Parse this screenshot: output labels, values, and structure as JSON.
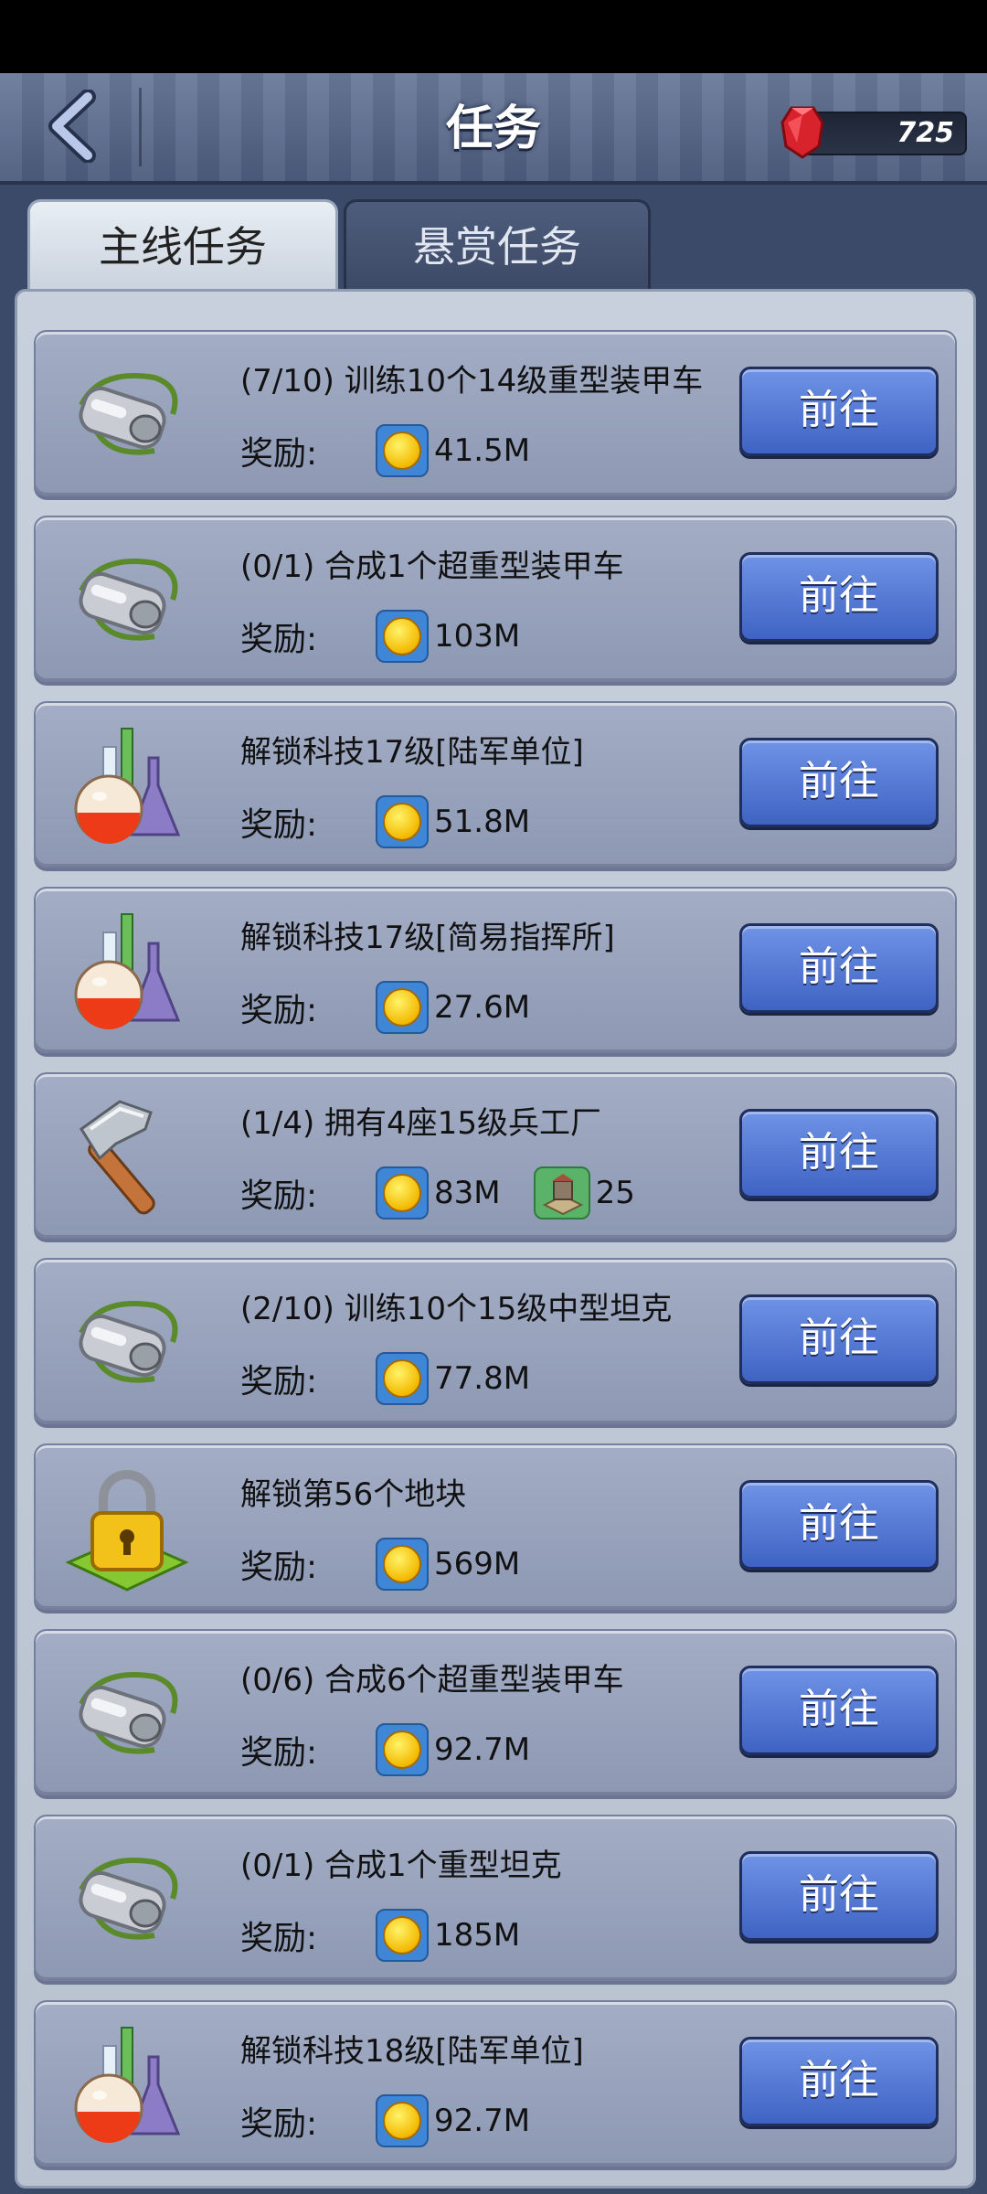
{
  "header": {
    "title": "任务",
    "gems": "725"
  },
  "tabs": [
    {
      "label": "主线任务",
      "active": true
    },
    {
      "label": "悬赏任务",
      "active": false
    }
  ],
  "reward_label": "奖励:",
  "go_label": "前往",
  "tasks": [
    {
      "icon": "whistle-icon",
      "title": "(7/10) 训练10个14级重型装甲车",
      "reward": "41.5M"
    },
    {
      "icon": "whistle-icon",
      "title": "(0/1) 合成1个超重型装甲车",
      "reward": "103M"
    },
    {
      "icon": "flask-icon",
      "title": "解锁科技17级[陆军单位]",
      "reward": "51.8M"
    },
    {
      "icon": "flask-icon",
      "title": "解锁科技17级[简易指挥所]",
      "reward": "27.6M"
    },
    {
      "icon": "hammer-icon",
      "title": "(1/4) 拥有4座15级兵工厂",
      "reward": "83M",
      "extra_reward": "25"
    },
    {
      "icon": "whistle-icon",
      "title": "(2/10) 训练10个15级中型坦克",
      "reward": "77.8M"
    },
    {
      "icon": "lock-icon",
      "title": "解锁第56个地块",
      "reward": "569M"
    },
    {
      "icon": "whistle-icon",
      "title": "(0/6) 合成6个超重型装甲车",
      "reward": "92.7M"
    },
    {
      "icon": "whistle-icon",
      "title": "(0/1) 合成1个重型坦克",
      "reward": "185M"
    },
    {
      "icon": "flask-icon",
      "title": "解锁科技18级[陆军单位]",
      "reward": "92.7M"
    }
  ]
}
